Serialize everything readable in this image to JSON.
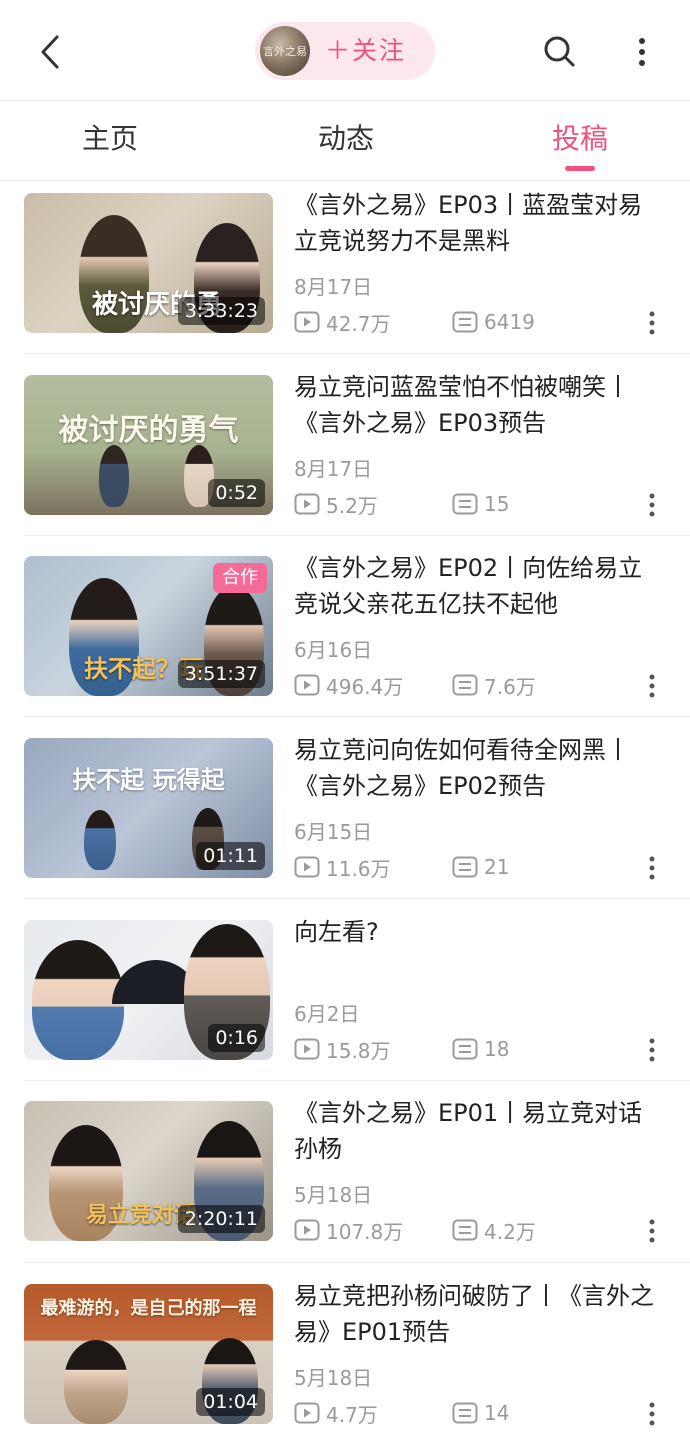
{
  "header": {
    "avatar_text": "言外之易",
    "follow_label": "＋关注"
  },
  "tabs": [
    {
      "label": "主页",
      "active": false
    },
    {
      "label": "动态",
      "active": false
    },
    {
      "label": "投稿",
      "active": true
    }
  ],
  "colors": {
    "accent": "#f0527f",
    "pill_bg": "#fce7ef",
    "meta": "#9a9a9a"
  },
  "videos": [
    {
      "title": "《言外之易》EP03丨蓝盈莹对易立竞说努力不是黑料",
      "date": "8月17日",
      "views": "42.7万",
      "comments": "6419",
      "duration": "3:33:23",
      "thumb_text": "被讨厌的勇",
      "coop": ""
    },
    {
      "title": "易立竞问蓝盈莹怕不怕被嘲笑丨《言外之易》EP03预告",
      "date": "8月17日",
      "views": "5.2万",
      "comments": "15",
      "duration": "0:52",
      "thumb_text": "被讨厌的勇气",
      "coop": ""
    },
    {
      "title": "《言外之易》EP02丨向佐给易立竞说父亲花五亿扶不起他",
      "date": "6月16日",
      "views": "496.4万",
      "comments": "7.6万",
      "duration": "3:51:37",
      "thumb_text": "扶不起？玩",
      "coop": "合作"
    },
    {
      "title": "易立竞问向佐如何看待全网黑丨《言外之易》EP02预告",
      "date": "6月15日",
      "views": "11.6万",
      "comments": "21",
      "duration": "01:11",
      "thumb_text": "扶不起 玩得起",
      "coop": ""
    },
    {
      "title": "向左看?",
      "date": "6月2日",
      "views": "15.8万",
      "comments": "18",
      "duration": "0:16",
      "thumb_text": "",
      "coop": ""
    },
    {
      "title": "《言外之易》EP01丨易立竞对话孙杨",
      "date": "5月18日",
      "views": "107.8万",
      "comments": "4.2万",
      "duration": "2:20:11",
      "thumb_text": "易立竞对话",
      "coop": ""
    },
    {
      "title": "易立竞把孙杨问破防了丨《言外之易》EP01预告",
      "date": "5月18日",
      "views": "4.7万",
      "comments": "14",
      "duration": "01:04",
      "thumb_text": "最难游的，是自己的那一程",
      "coop": ""
    }
  ]
}
